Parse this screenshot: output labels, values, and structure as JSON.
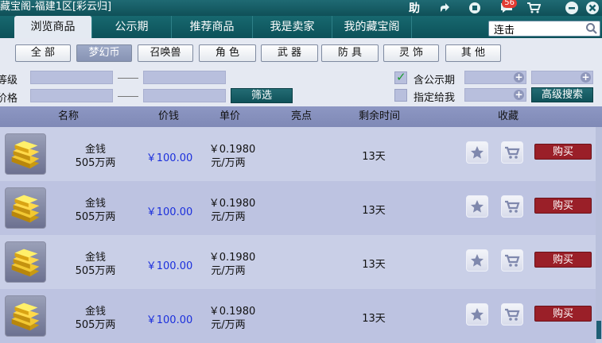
{
  "window": {
    "title": "藏宝阁-福建1区[彩云归]"
  },
  "titlebar_buttons": [
    {
      "name": "help",
      "label": "助"
    },
    {
      "name": "share",
      "label": ""
    },
    {
      "name": "stop",
      "label": ""
    },
    {
      "name": "messages",
      "label": "",
      "badge": "56"
    }
  ],
  "tabs": [
    "浏览商品",
    "公示期",
    "推荐商品",
    "我是卖家",
    "我的藏宝阁"
  ],
  "search": {
    "value": "连击",
    "placeholder": ""
  },
  "categories": [
    "全 部",
    "梦幻币",
    "召唤兽",
    "角 色",
    "武 器",
    "防 具",
    "灵 饰",
    "其 他"
  ],
  "filters": {
    "level_label": "等级",
    "price_label": "价格",
    "filter_button": "筛选",
    "include_public_label": "含公示期",
    "include_public_checked": true,
    "assigned_to_me_label": "指定给我",
    "assigned_to_me_checked": false,
    "advanced_button": "高级搜索"
  },
  "table": {
    "headers": [
      "名称",
      "价钱",
      "单价",
      "亮点",
      "剩余时间",
      "收藏"
    ],
    "buy_label": "购买",
    "rows": [
      {
        "name_line1": "金钱",
        "name_line2": "505万两",
        "price": "￥100.00",
        "unit_line1": "￥0.1980",
        "unit_line2": "元/万两",
        "highlight": "",
        "remaining": "13天"
      },
      {
        "name_line1": "金钱",
        "name_line2": "505万两",
        "price": "￥100.00",
        "unit_line1": "￥0.1980",
        "unit_line2": "元/万两",
        "highlight": "",
        "remaining": "13天"
      },
      {
        "name_line1": "金钱",
        "name_line2": "505万两",
        "price": "￥100.00",
        "unit_line1": "￥0.1980",
        "unit_line2": "元/万两",
        "highlight": "",
        "remaining": "13天"
      },
      {
        "name_line1": "金钱",
        "name_line2": "505万两",
        "price": "￥100.00",
        "unit_line1": "￥0.1980",
        "unit_line2": "元/万两",
        "highlight": "",
        "remaining": "13天"
      }
    ]
  },
  "colors": {
    "accent": "#0f5058",
    "price": "#1b2fdc",
    "buy": "#9a1f28"
  }
}
